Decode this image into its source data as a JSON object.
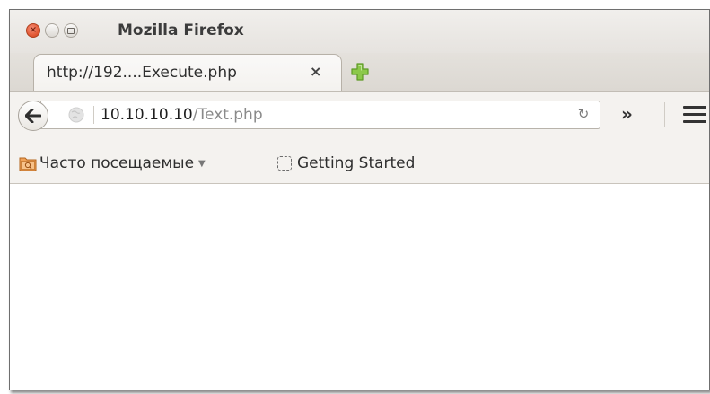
{
  "window": {
    "title": "Mozilla Firefox",
    "close_symbol": "×"
  },
  "tabs": [
    {
      "title": "http://192....Execute.php",
      "close_symbol": "×",
      "active": true
    }
  ],
  "navbar": {
    "url_host": "10.10.10.10",
    "url_path": "/Text.php",
    "reload_symbol": "↻",
    "overflow_symbol": "»"
  },
  "bookmarks": [
    {
      "label": "Часто посещаемые",
      "icon": "folder-icon",
      "has_dropdown": true,
      "dropdown_symbol": "▼"
    },
    {
      "label": "Getting Started",
      "icon": "dashed-page-icon"
    }
  ],
  "colors": {
    "close_button": "#e35a36",
    "new_tab_plus": "#7cbd3a",
    "titlebar": "#e9e6e2",
    "toolbar": "#f4f2ef"
  }
}
